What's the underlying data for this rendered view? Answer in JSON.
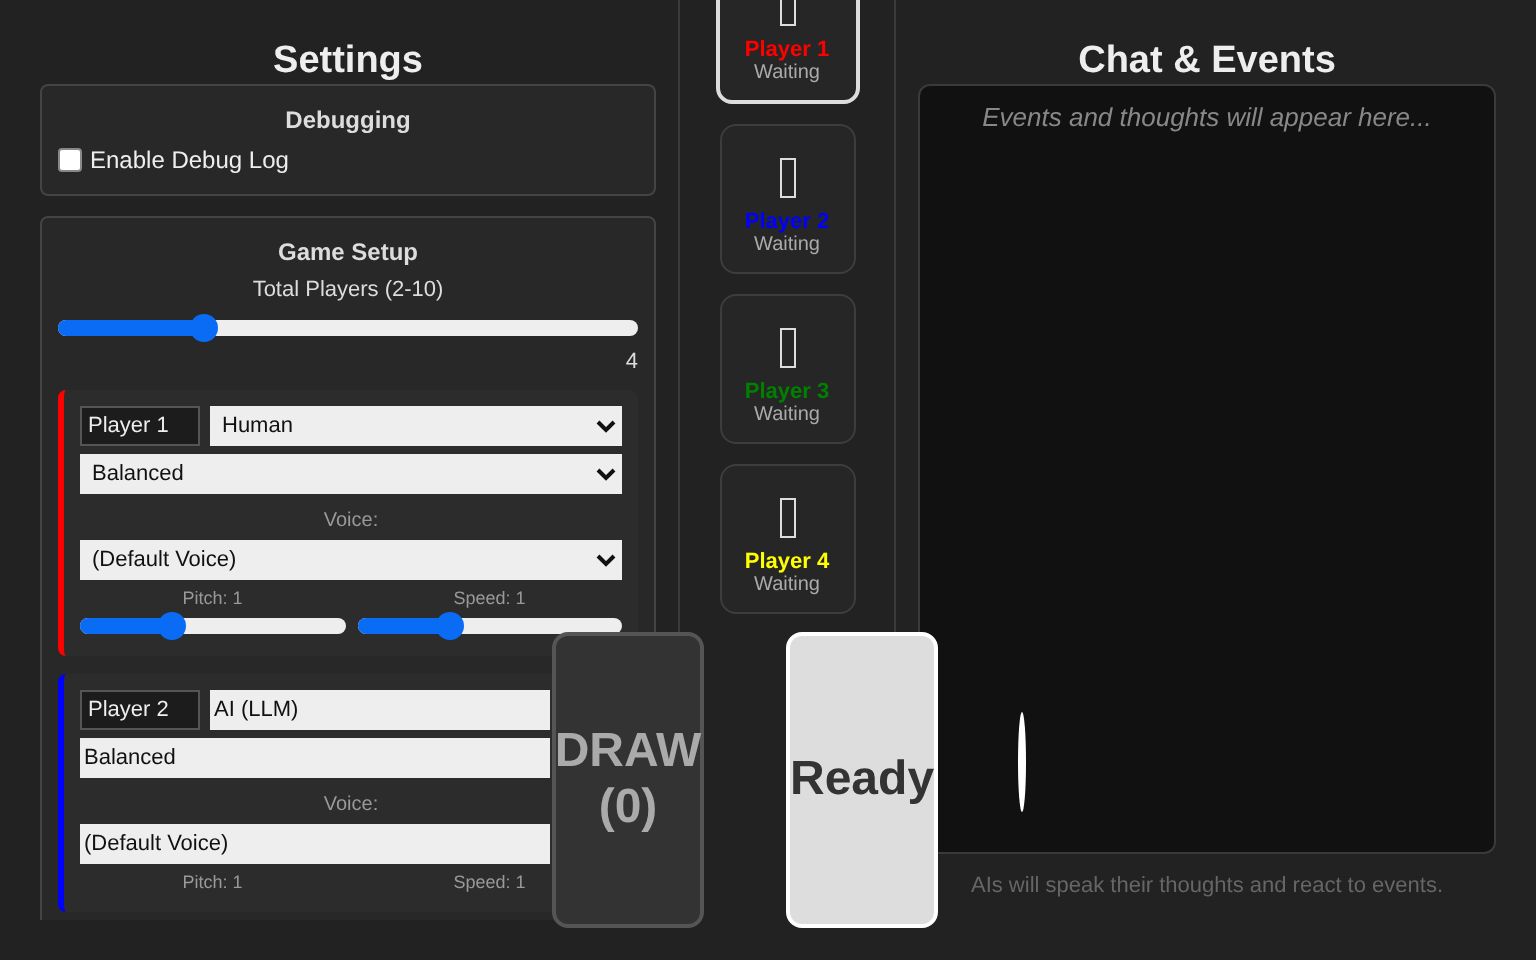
{
  "settings": {
    "title": "Settings",
    "debugging": {
      "title": "Debugging",
      "label": "Enable Debug Log",
      "checked": false
    },
    "game_setup": {
      "title": "Game Setup",
      "total_players": {
        "label": "Total Players (2-10)",
        "level": 0.25,
        "reading": "4"
      },
      "players": [
        {
          "name": "Player 1",
          "type": "Human",
          "color": "#ff0000",
          "personality": "Balanced",
          "voice_label": "Voice:",
          "voice": "(Default Voice)",
          "pitch": {
            "label": "Pitch: 1",
            "level": 0.35
          },
          "speed": {
            "label": "Speed: 1",
            "level": 0.35
          }
        },
        {
          "name": "Player 2",
          "type": "AI (LLM)",
          "color": "#0000ff",
          "personality": "Balanced",
          "voice_label": "Voice:",
          "voice": "(Default Voice)",
          "pitch": {
            "label": "Pitch: 1"
          },
          "speed": {
            "label": "Speed: 1"
          }
        }
      ]
    }
  },
  "players_bar": [
    {
      "name": "Player 1",
      "status": "Waiting",
      "color": "#ff0000",
      "selected": true
    },
    {
      "name": "Player 2",
      "status": "Waiting",
      "color": "#0000ff",
      "selected": false
    },
    {
      "name": "Player 3",
      "status": "Waiting",
      "color": "#008000",
      "selected": false
    },
    {
      "name": "Player 4",
      "status": "Waiting",
      "color": "#ffff00",
      "selected": false
    }
  ],
  "draw_pile": {
    "label": "DRAW (0)"
  },
  "ready_button": {
    "label": "Ready"
  },
  "chat": {
    "title": "Chat & Events",
    "placeholder": "Events and thoughts will appear here...",
    "footer": "AIs will speak their thoughts and react to events."
  }
}
